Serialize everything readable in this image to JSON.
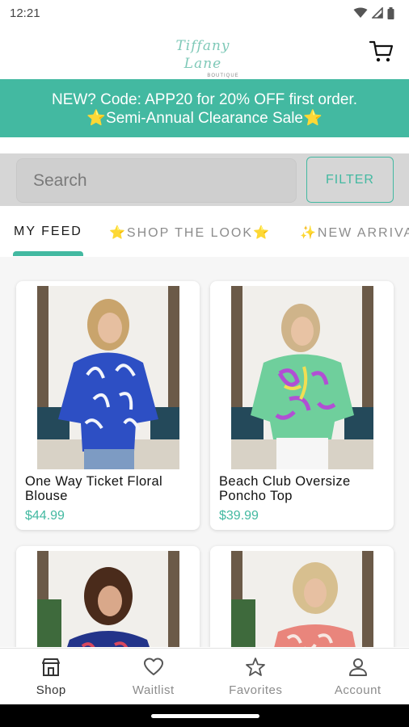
{
  "status_bar": {
    "time": "12:21"
  },
  "header": {
    "logo_script": "Tiffany Lane",
    "logo_sub": "BOUTIQUE"
  },
  "promo": {
    "line1": "NEW?  Code:  APP20 for 20% OFF first order.",
    "line2": "⭐Semi-Annual Clearance Sale⭐",
    "color": "#43b9a1"
  },
  "search": {
    "placeholder": "Search",
    "filter_label": "FILTER"
  },
  "tabs": [
    {
      "label": "MY FEED"
    },
    {
      "label": "⭐SHOP THE LOOK⭐"
    },
    {
      "label": "✨NEW ARRIVALS"
    }
  ],
  "products": [
    {
      "name": "One Way Ticket Floral Blouse",
      "price": "$44.99",
      "image_icon": "model-blue-floral-blouse"
    },
    {
      "name": "Beach Club Oversize Poncho Top",
      "price": "$39.99",
      "image_icon": "model-green-print-poncho"
    },
    {
      "name": "",
      "price": "",
      "image_icon": "model-navy-print-top"
    },
    {
      "name": "",
      "price": "",
      "image_icon": "model-coral-print-top"
    }
  ],
  "bottom_nav": [
    {
      "label": "Shop",
      "icon": "shop-icon"
    },
    {
      "label": "Waitlist",
      "icon": "heart-icon"
    },
    {
      "label": "Favorites",
      "icon": "star-icon"
    },
    {
      "label": "Account",
      "icon": "person-icon"
    }
  ],
  "colors": {
    "accent": "#43b9a1",
    "search_strip": "#d6d6d6",
    "feed_bg": "#f6f6f6"
  }
}
